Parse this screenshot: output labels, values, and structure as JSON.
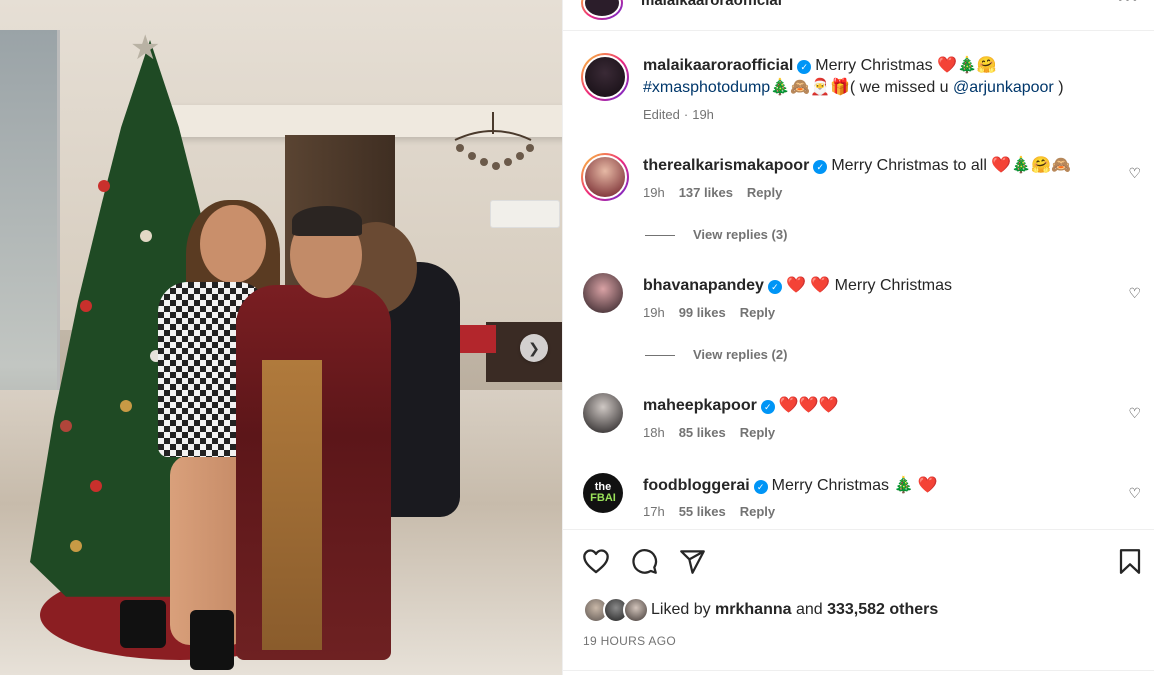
{
  "post": {
    "author": "malaikaaroraofficial",
    "more_label": "•••"
  },
  "caption": {
    "username": "malaikaaroraofficial",
    "text": "Merry Christmas ❤️🎄🤗",
    "hashtag": "#xmasphotodump",
    "emoji_after_hashtag": "🎄🙈🎅🎁",
    "text_end_prefix": "( we missed u ",
    "mention": "@arjunkapoor",
    "text_end_suffix": " )",
    "edited_label": "Edited",
    "edited_time": "19h"
  },
  "comments": [
    {
      "username": "therealkarismakapoor",
      "text": "Merry Christmas to all ❤️🎄🤗🙈",
      "time": "19h",
      "likes": "137 likes",
      "reply_label": "Reply",
      "view_replies": "View replies (3)"
    },
    {
      "username": "bhavanapandey",
      "text": "❤️ ❤️ Merry Christmas",
      "time": "19h",
      "likes": "99 likes",
      "reply_label": "Reply",
      "view_replies": "View replies (2)"
    },
    {
      "username": "maheepkapoor",
      "text": "❤️❤️❤️",
      "time": "18h",
      "likes": "85 likes",
      "reply_label": "Reply"
    },
    {
      "username": "foodbloggerai",
      "text": "Merry Christmas 🎄 ❤️",
      "time": "17h",
      "likes": "55 likes",
      "reply_label": "Reply"
    }
  ],
  "likes_summary": {
    "prefix": "Liked by ",
    "user": "mrkhanna",
    "middle": " and ",
    "count": "333,582 others"
  },
  "timestamp": "19 HOURS AGO",
  "icons": {
    "like": "heart-icon",
    "comment": "comment-icon",
    "share": "share-icon",
    "save": "bookmark-icon",
    "carousel_next": "chevron-right-icon",
    "verified": "verified-badge-icon"
  },
  "colors": {
    "verified": "#0095f6",
    "link": "#00376b",
    "secondary_text": "#737373"
  }
}
